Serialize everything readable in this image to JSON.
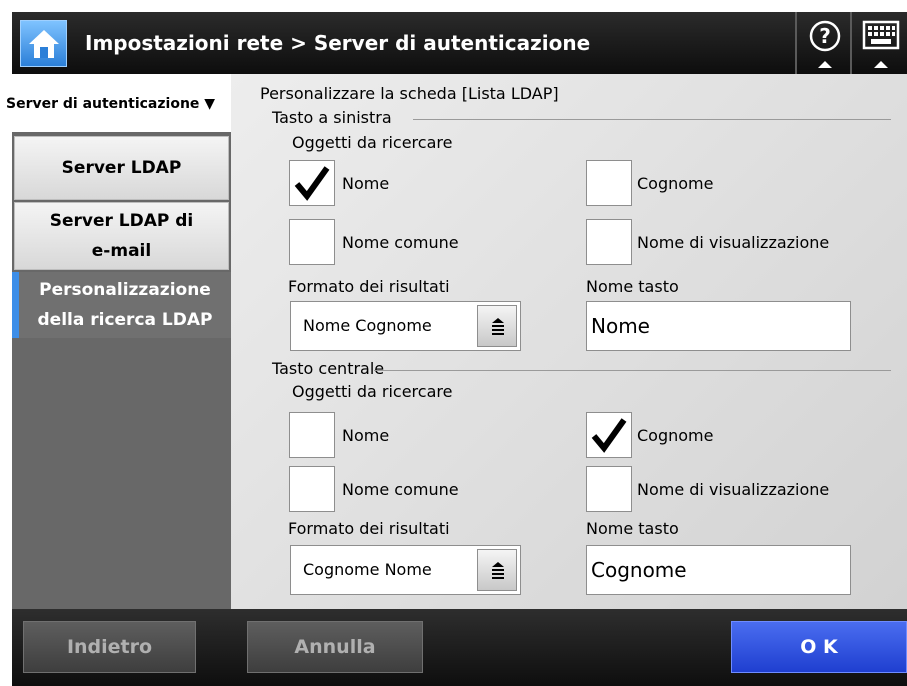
{
  "header": {
    "title": "Impostazioni rete > Server di autenticazione",
    "home_icon": "home-icon",
    "help_icon": "help-icon",
    "keyboard_icon": "keyboard-icon"
  },
  "sidebar": {
    "header_label": "Server di autenticazione ▼",
    "items": [
      {
        "label": "Server LDAP",
        "active": false
      },
      {
        "label": "Server LDAP di e-mail",
        "active": false
      },
      {
        "label": "Personalizzazione della ricerca LDAP",
        "active": true
      }
    ]
  },
  "main": {
    "heading": "Personalizzare la scheda [Lista LDAP]",
    "left_button": {
      "group_label": "Tasto a sinistra",
      "search_objects_label": "Oggetti da ricercare",
      "checkboxes": [
        {
          "label": "Nome",
          "checked": true
        },
        {
          "label": "Cognome",
          "checked": false
        },
        {
          "label": "Nome comune",
          "checked": false
        },
        {
          "label": "Nome di visualizzazione",
          "checked": false
        }
      ],
      "result_format_label": "Formato dei risultati",
      "result_format_value": "Nome Cognome",
      "button_name_label": "Nome tasto",
      "button_name_value": "Nome"
    },
    "center_button": {
      "group_label": "Tasto centrale",
      "search_objects_label": "Oggetti da ricercare",
      "checkboxes": [
        {
          "label": "Nome",
          "checked": false
        },
        {
          "label": "Cognome",
          "checked": true
        },
        {
          "label": "Nome comune",
          "checked": false
        },
        {
          "label": "Nome di visualizzazione",
          "checked": false
        }
      ],
      "result_format_label": "Formato dei risultati",
      "result_format_value": "Cognome Nome",
      "button_name_label": "Nome tasto",
      "button_name_value": "Cognome"
    }
  },
  "footer": {
    "back_label": "Indietro",
    "cancel_label": "Annulla",
    "ok_label": "O K"
  },
  "colors": {
    "accent_blue": "#3d8ee8",
    "ok_blue": "#2b4fe0"
  }
}
